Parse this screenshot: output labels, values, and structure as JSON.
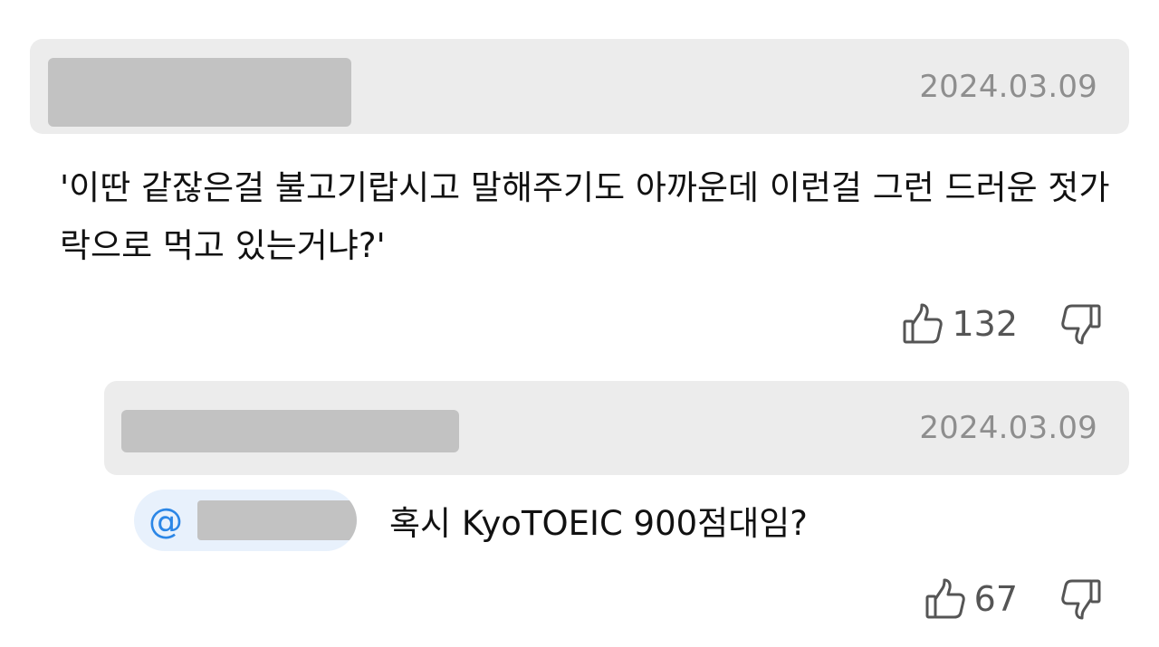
{
  "comment": {
    "date": "2024.03.09",
    "text": "'이딴 같잖은걸 불고기랍시고 말해주기도 아까운데 이런걸 그런 드러운 젓가락으로 먹고 있는거냐?'",
    "likes": "132"
  },
  "reply": {
    "date": "2024.03.09",
    "mention_prefix": "@",
    "text": "혹시 KyoTOEIC 900점대임?",
    "likes": "67"
  },
  "icons": {
    "like": "thumbs-up-outline-icon",
    "dislike": "thumbs-down-outline-icon"
  },
  "colors": {
    "header_bg": "#ececec",
    "date_text": "#8e8e8e",
    "mention_text": "#2b86e6",
    "mention_bg": "#e8f1fc"
  }
}
